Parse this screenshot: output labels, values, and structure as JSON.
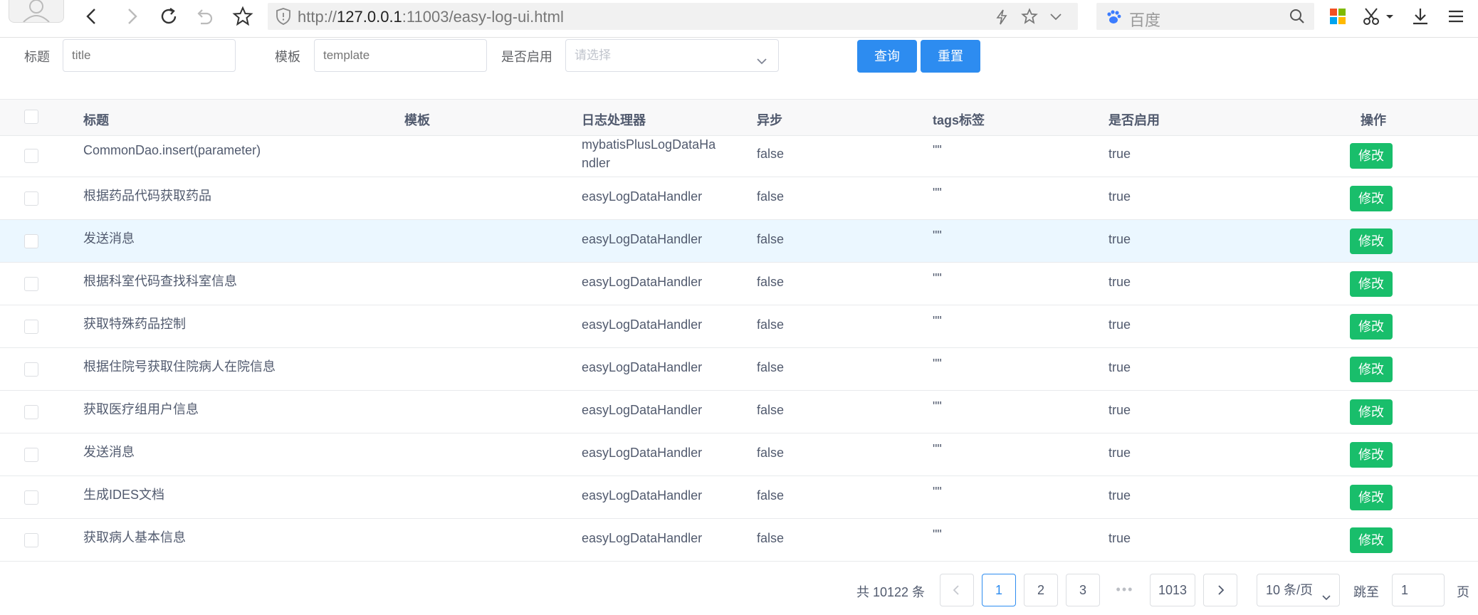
{
  "browser": {
    "url_scheme": "http://",
    "url_host": "127.0.0.1",
    "url_rest": ":11003/easy-log-ui.html",
    "search_placeholder": "百度"
  },
  "filters": {
    "title_label": "标题",
    "title_placeholder": "title",
    "template_label": "模板",
    "template_placeholder": "template",
    "enabled_label": "是否启用",
    "enabled_placeholder": "请选择",
    "query_button": "查询",
    "reset_button": "重置"
  },
  "table": {
    "headers": {
      "title": "标题",
      "template": "模板",
      "handler": "日志处理器",
      "async": "异步",
      "tags": "tags标签",
      "enabled": "是否启用",
      "action": "操作"
    },
    "edit_label": "修改",
    "rows": [
      {
        "title": "CommonDao.insert(parameter)",
        "template": "",
        "handler_line1": "mybatisPlusLogDataHa",
        "handler_line2": "ndler",
        "async": "false",
        "tags": "\"\"",
        "enabled": "true"
      },
      {
        "title": "根据药品代码获取药品",
        "template": "",
        "handler_line1": "easyLogDataHandler",
        "handler_line2": "",
        "async": "false",
        "tags": "\"\"",
        "enabled": "true"
      },
      {
        "title": "发送消息",
        "template": "",
        "handler_line1": "easyLogDataHandler",
        "handler_line2": "",
        "async": "false",
        "tags": "\"\"",
        "enabled": "true"
      },
      {
        "title": "根据科室代码查找科室信息",
        "template": "",
        "handler_line1": "easyLogDataHandler",
        "handler_line2": "",
        "async": "false",
        "tags": "\"\"",
        "enabled": "true"
      },
      {
        "title": "获取特殊药品控制",
        "template": "",
        "handler_line1": "easyLogDataHandler",
        "handler_line2": "",
        "async": "false",
        "tags": "\"\"",
        "enabled": "true"
      },
      {
        "title": "根据住院号获取住院病人在院信息",
        "template": "",
        "handler_line1": "easyLogDataHandler",
        "handler_line2": "",
        "async": "false",
        "tags": "\"\"",
        "enabled": "true"
      },
      {
        "title": "获取医疗组用户信息",
        "template": "",
        "handler_line1": "easyLogDataHandler",
        "handler_line2": "",
        "async": "false",
        "tags": "\"\"",
        "enabled": "true"
      },
      {
        "title": "发送消息",
        "template": "",
        "handler_line1": "easyLogDataHandler",
        "handler_line2": "",
        "async": "false",
        "tags": "\"\"",
        "enabled": "true"
      },
      {
        "title": "生成IDES文档",
        "template": "",
        "handler_line1": "easyLogDataHandler",
        "handler_line2": "",
        "async": "false",
        "tags": "\"\"",
        "enabled": "true"
      },
      {
        "title": "获取病人基本信息",
        "template": "",
        "handler_line1": "easyLogDataHandler",
        "handler_line2": "",
        "async": "false",
        "tags": "\"\"",
        "enabled": "true"
      }
    ]
  },
  "pagination": {
    "total_text": "共 10122 条",
    "pages": [
      "1",
      "2",
      "3"
    ],
    "ellipsis": "•••",
    "last_page": "1013",
    "current_page": "1",
    "page_size": "10 条/页",
    "jump_label": "跳至",
    "jump_value": "1",
    "page_unit": "页"
  },
  "colors": {
    "primary": "#2d8cf0",
    "success": "#19be6b",
    "row_highlight": "#ebf7ff"
  }
}
